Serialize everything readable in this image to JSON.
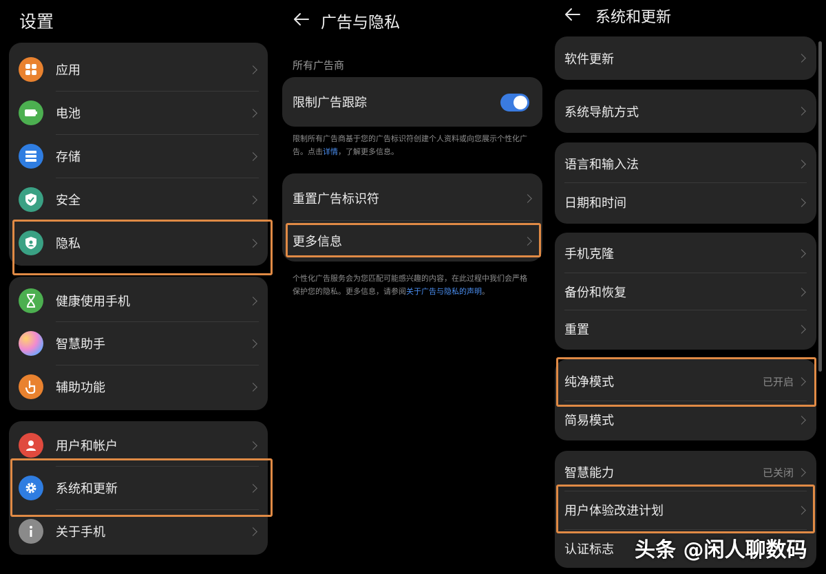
{
  "settings": {
    "title": "设置",
    "group1": [
      {
        "label": "应用"
      },
      {
        "label": "电池"
      },
      {
        "label": "存储"
      },
      {
        "label": "安全"
      },
      {
        "label": "隐私"
      }
    ],
    "group2": [
      {
        "label": "健康使用手机"
      },
      {
        "label": "智慧助手"
      },
      {
        "label": "辅助功能"
      }
    ],
    "group3": [
      {
        "label": "用户和帐户"
      },
      {
        "label": "系统和更新"
      },
      {
        "label": "关于手机"
      }
    ]
  },
  "ads": {
    "title": "广告与隐私",
    "section_header": "所有广告商",
    "limit_tracking": {
      "label": "限制广告跟踪",
      "enabled": true
    },
    "limit_desc": {
      "text1": "限制所有广告商基于您的广告标识符创建个人资料或向您展示个性化广",
      "text2_prefix": "告。点击",
      "link": "详情",
      "text2_suffix": "，了解更多信息。"
    },
    "reset_id": "重置广告标识符",
    "more_info": "更多信息",
    "personal_desc": {
      "text1": "个性化广告服务会为您匹配可能感兴趣的内容，在此过程中我们会严格",
      "text2_prefix": "保护您的隐私。更多信息，请参阅",
      "link": "关于广告与隐私的声明",
      "text2_suffix": "。"
    }
  },
  "system": {
    "title": "系统和更新",
    "software_update": "软件更新",
    "navigation": "系统导航方式",
    "language": "语言和输入法",
    "datetime": "日期和时间",
    "phone_clone": "手机克隆",
    "backup": "备份和恢复",
    "reset": "重置",
    "pure_mode": {
      "label": "纯净模式",
      "value": "已开启"
    },
    "simple_mode": "简易模式",
    "smart_ability": {
      "label": "智慧能力",
      "value": "已关闭"
    },
    "ux_plan": "用户体验改进计划",
    "cert": "认证标志"
  },
  "watermark": "头条 @闲人聊数码",
  "colors": {
    "highlight": "#e08a45",
    "toggle_on": "#3a7be0",
    "link": "#4a8ef0",
    "card_bg": "#262626"
  }
}
